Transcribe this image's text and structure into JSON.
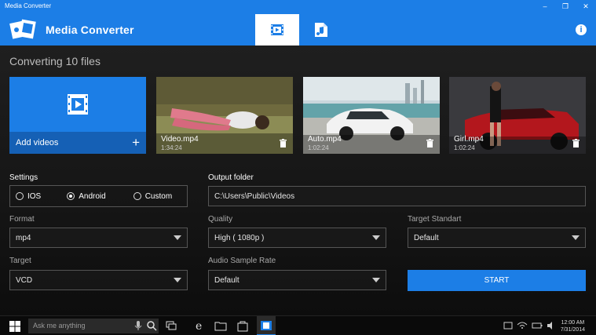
{
  "window": {
    "title": "Media Converter",
    "controls": [
      "–",
      "❐",
      "✕"
    ]
  },
  "app": {
    "name": "Media Converter"
  },
  "tabs": [
    {
      "name": "video",
      "active": true
    },
    {
      "name": "audio",
      "active": false
    }
  ],
  "main": {
    "heading": "Converting 10 files"
  },
  "add_tile": {
    "label": "Add videos",
    "plus": "+"
  },
  "files": [
    {
      "name": "Video.mp4",
      "duration": "1:34:24"
    },
    {
      "name": "Auto.mp4",
      "duration": "1:02:24"
    },
    {
      "name": "Girl.mp4",
      "duration": "1:02:24"
    }
  ],
  "settings": {
    "label": "Settings",
    "options": [
      {
        "label": "IOS",
        "selected": false
      },
      {
        "label": "Android",
        "selected": true
      },
      {
        "label": "Custom",
        "selected": false
      }
    ]
  },
  "output_folder": {
    "label": "Output folder",
    "value": "C:\\Users\\Public\\Videos"
  },
  "format": {
    "label": "Format",
    "value": "mp4"
  },
  "quality": {
    "label": "Quality",
    "value": "High ( 1080p )"
  },
  "target_standart": {
    "label": "Target Standart",
    "value": "Default"
  },
  "target": {
    "label": "Target",
    "value": "VCD"
  },
  "audio_sample_rate": {
    "label": "Audio Sample Rate",
    "value": "Default"
  },
  "start_button": {
    "label": "START"
  },
  "taskbar": {
    "search_placeholder": "Ask me anything",
    "time": "12:00 AM",
    "date": "7/31/2014"
  },
  "colors": {
    "accent": "#1c7ee6",
    "accent_dark": "#1560b5",
    "background": "#151515"
  }
}
